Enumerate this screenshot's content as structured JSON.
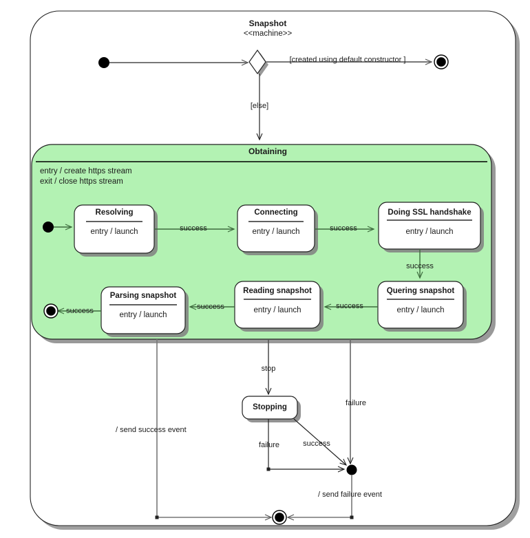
{
  "machine": {
    "title": "Snapshot",
    "stereotype": "<<machine>>"
  },
  "colors": {
    "composite_fill": "#b3f2b3",
    "state_fill": "#ffffff",
    "line": "#333333",
    "green_line": "#3d6b3d",
    "shadow": "#808080",
    "text": "#1a1a1a"
  },
  "composite_state": {
    "name": "Obtaining",
    "internal_actions": [
      "entry / create https stream",
      "exit / close https stream"
    ]
  },
  "states": [
    {
      "id": "resolving",
      "name": "Resolving",
      "body": "entry / launch"
    },
    {
      "id": "connecting",
      "name": "Connecting",
      "body": "entry / launch"
    },
    {
      "id": "ssl",
      "name": "Doing SSL handshake",
      "body": "entry / launch"
    },
    {
      "id": "quering",
      "name": "Quering snapshot",
      "body": "entry / launch"
    },
    {
      "id": "reading",
      "name": "Reading snapshot",
      "body": "entry / launch"
    },
    {
      "id": "parsing",
      "name": "Parsing snapshot",
      "body": "entry / launch"
    },
    {
      "id": "stopping",
      "name": "Stopping",
      "body": ""
    }
  ],
  "pseudostates": [
    {
      "id": "machine-initial",
      "kind": "initial"
    },
    {
      "id": "choice",
      "kind": "choice"
    },
    {
      "id": "machine-final-tr",
      "kind": "final"
    },
    {
      "id": "region-initial",
      "kind": "initial"
    },
    {
      "id": "region-final",
      "kind": "final"
    },
    {
      "id": "junction",
      "kind": "junction"
    },
    {
      "id": "machine-final",
      "kind": "final"
    }
  ],
  "transitions": [
    {
      "id": "t1",
      "from": "machine-initial",
      "to": "choice",
      "label": ""
    },
    {
      "id": "t2",
      "from": "choice",
      "to": "machine-final-tr",
      "label": "[created using default constructor ]"
    },
    {
      "id": "t3",
      "from": "choice",
      "to": "obtaining",
      "label": "[else]"
    },
    {
      "id": "t4",
      "from": "region-initial",
      "to": "resolving",
      "label": ""
    },
    {
      "id": "t5",
      "from": "resolving",
      "to": "connecting",
      "label": "success"
    },
    {
      "id": "t6",
      "from": "connecting",
      "to": "ssl",
      "label": "success"
    },
    {
      "id": "t7",
      "from": "ssl",
      "to": "quering",
      "label": "success"
    },
    {
      "id": "t8",
      "from": "quering",
      "to": "reading",
      "label": "success"
    },
    {
      "id": "t9",
      "from": "reading",
      "to": "parsing",
      "label": "success"
    },
    {
      "id": "t10",
      "from": "parsing",
      "to": "region-final",
      "label": "success"
    },
    {
      "id": "t11",
      "from": "obtaining",
      "to": "stopping",
      "label": "stop"
    },
    {
      "id": "t12",
      "from": "obtaining",
      "to": "junction",
      "label": "failure"
    },
    {
      "id": "t13",
      "from": "stopping",
      "to": "junction",
      "label": "failure"
    },
    {
      "id": "t14",
      "from": "stopping",
      "to": "junction",
      "label": "success"
    },
    {
      "id": "t15",
      "from": "obtaining",
      "to": "machine-final",
      "label": "/ send success event"
    },
    {
      "id": "t16",
      "from": "junction",
      "to": "machine-final",
      "label": "/ send failure event"
    }
  ],
  "edge_labels": {
    "created_default": "[created using default constructor ]",
    "else": "[else]",
    "success": "success",
    "stop": "stop",
    "failure": "failure",
    "send_success_event": "/ send success event",
    "send_failure_event": "/ send failure event"
  }
}
